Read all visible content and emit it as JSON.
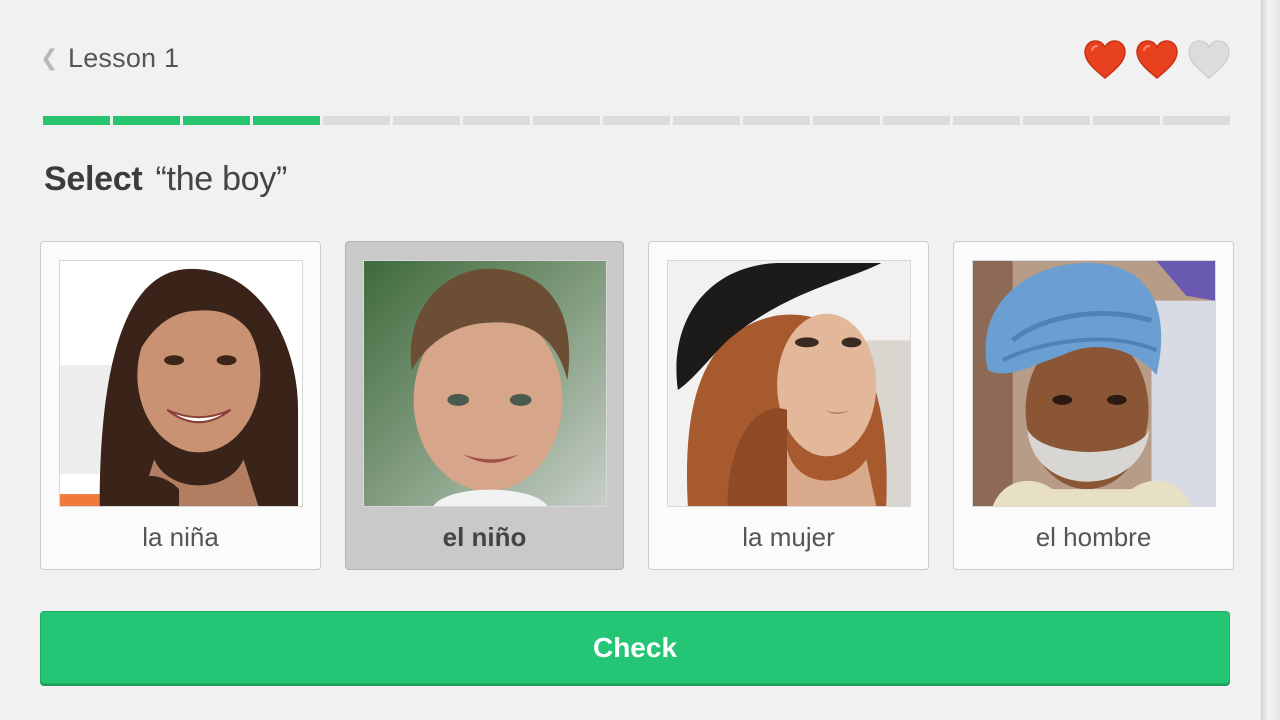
{
  "header": {
    "back_icon": "chevron-left-icon",
    "title": "Lesson 1",
    "hearts": [
      {
        "icon": "heart-icon",
        "state": "full",
        "color": "#e8411f"
      },
      {
        "icon": "heart-icon",
        "state": "full",
        "color": "#e8411f"
      },
      {
        "icon": "heart-icon",
        "state": "empty",
        "color": "#dcdcdc"
      }
    ]
  },
  "progress": {
    "total_segments": 17,
    "completed_segments": 4,
    "color_done": "#26c46f",
    "color_todo": "#dcdcdc"
  },
  "prompt": {
    "verb": "Select",
    "target": "“the boy”"
  },
  "choices": [
    {
      "label": "la niña",
      "selected": false
    },
    {
      "label": "el niño",
      "selected": true
    },
    {
      "label": "la mujer",
      "selected": false
    },
    {
      "label": "el hombre",
      "selected": false
    }
  ],
  "check_button": {
    "label": "Check",
    "color": "#24c675"
  }
}
